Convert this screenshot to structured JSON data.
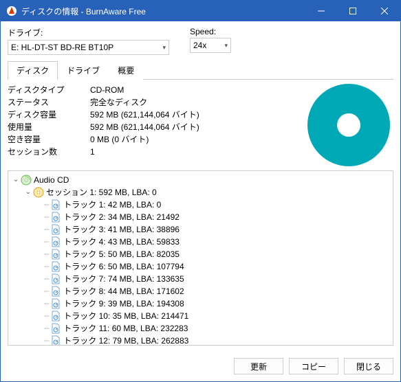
{
  "window": {
    "title": "ディスクの情報 - BurnAware Free"
  },
  "fields": {
    "drive_label": "ドライブ:",
    "drive_value": "E: HL-DT-ST BD-RE BT10P",
    "speed_label": "Speed:",
    "speed_value": "24x"
  },
  "tabs": {
    "disc": "ディスク",
    "drive": "ドライブ",
    "overview": "概要"
  },
  "info": {
    "disc_type_k": "ディスクタイプ",
    "disc_type_v": "CD-ROM",
    "status_k": "ステータス",
    "status_v": "完全なディスク",
    "capacity_k": "ディスク容量",
    "capacity_v": "592 MB (621,144,064 バイト)",
    "used_k": "使用量",
    "used_v": "592 MB (621,144,064 バイト)",
    "free_k": "空き容量",
    "free_v": "0 MB (0 バイト)",
    "sessions_k": "セッション数",
    "sessions_v": "1"
  },
  "tree": {
    "root": "Audio CD",
    "session": "セッション 1: 592 MB, LBA: 0",
    "tracks": [
      "トラック 1: 42 MB, LBA: 0",
      "トラック 2: 34 MB, LBA: 21492",
      "トラック 3: 41 MB, LBA: 38896",
      "トラック 4: 43 MB, LBA: 59833",
      "トラック 5: 50 MB, LBA: 82035",
      "トラック 6: 50 MB, LBA: 107794",
      "トラック 7: 74 MB, LBA: 133635",
      "トラック 8: 44 MB, LBA: 171602",
      "トラック 9: 39 MB, LBA: 194308",
      "トラック 10: 35 MB, LBA: 214471",
      "トラック 11: 60 MB, LBA: 232283",
      "トラック 12: 79 MB, LBA: 262883"
    ]
  },
  "buttons": {
    "refresh": "更新",
    "copy": "コピー",
    "close": "閉じる"
  }
}
